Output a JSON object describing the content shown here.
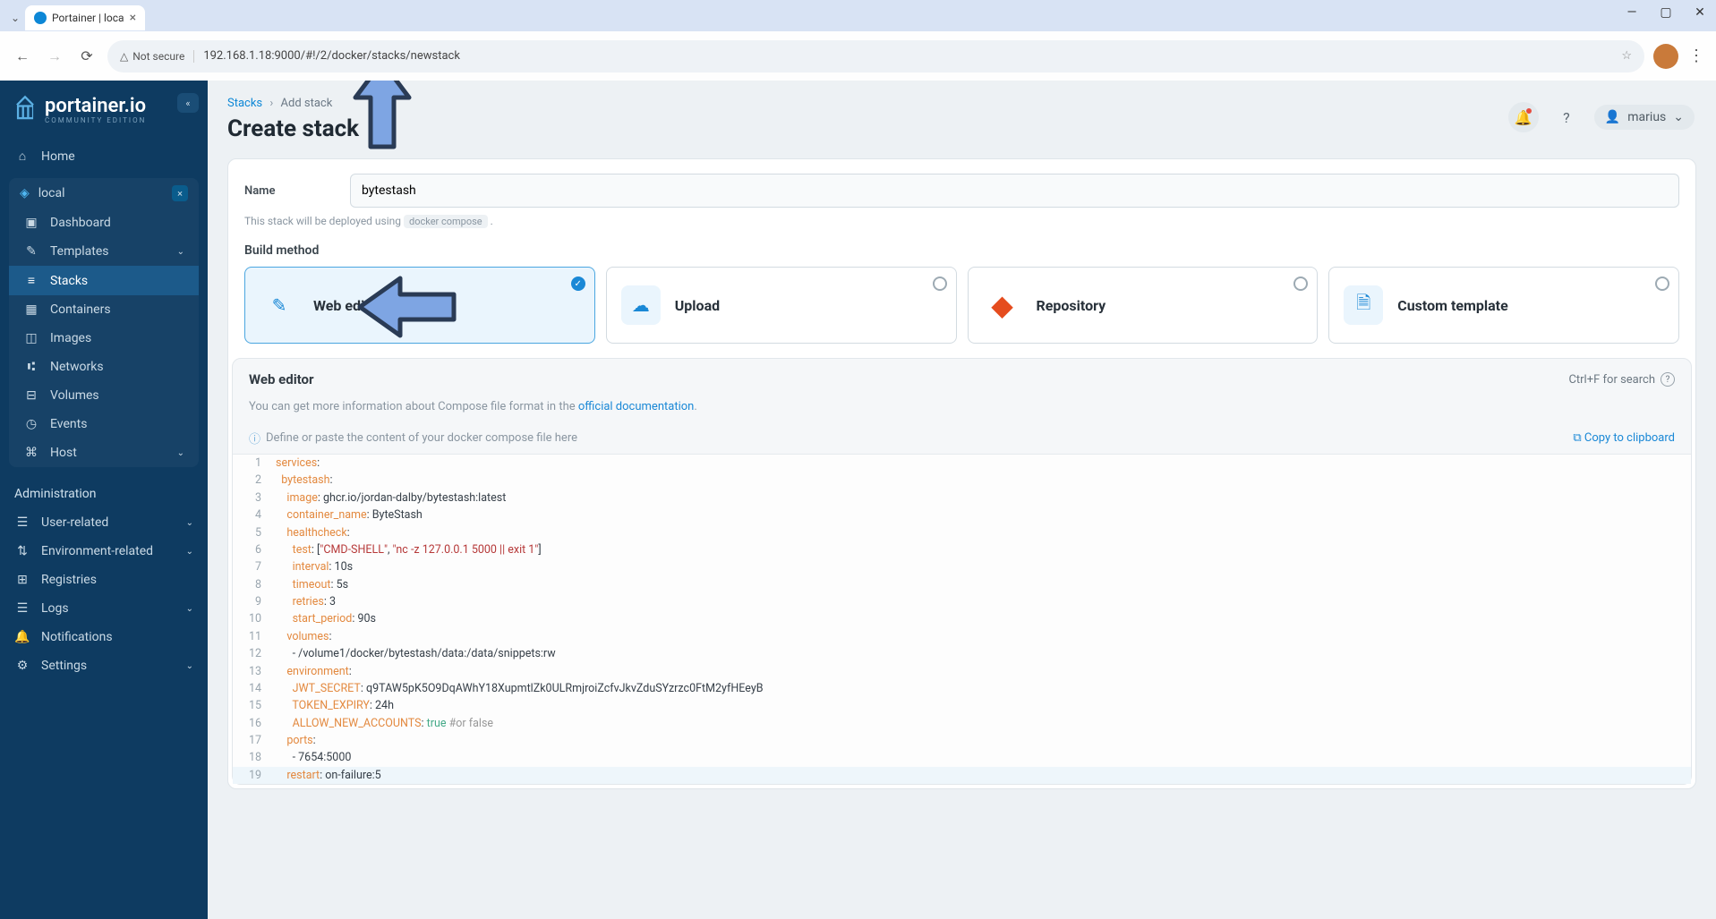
{
  "browser": {
    "tab_title": "Portainer | loca",
    "not_secure": "Not secure",
    "url": "192.168.1.18:9000/#!/2/docker/stacks/newstack"
  },
  "brand": {
    "name": "portainer.io",
    "edition": "COMMUNITY EDITION"
  },
  "sidebar": {
    "home": "Home",
    "env_name": "local",
    "items": [
      "Dashboard",
      "Templates",
      "Stacks",
      "Containers",
      "Images",
      "Networks",
      "Volumes",
      "Events",
      "Host"
    ],
    "admin_label": "Administration",
    "admin": [
      "User-related",
      "Environment-related",
      "Registries",
      "Logs",
      "Notifications",
      "Settings"
    ]
  },
  "breadcrumb": {
    "root": "Stacks",
    "current": "Add stack"
  },
  "page_title": "Create stack",
  "user_name": "marius",
  "form": {
    "name_label": "Name",
    "name_value": "bytestash",
    "deploy_hint_pre": "This stack will be deployed using",
    "deploy_hint_code": "docker compose",
    "deploy_hint_post": "."
  },
  "build": {
    "heading": "Build method",
    "methods": [
      "Web editor",
      "Upload",
      "Repository",
      "Custom template"
    ]
  },
  "editor": {
    "title": "Web editor",
    "search_hint": "Ctrl+F for search",
    "info_pre": "You can get more information about Compose file format in the ",
    "info_link": "official documentation",
    "info_post": ".",
    "placeholder_hint": "Define or paste the content of your docker compose file here",
    "copy": "Copy to clipboard"
  },
  "code": [
    {
      "n": 1,
      "html": "<span class='tok-key'>services</span>:"
    },
    {
      "n": 2,
      "html": "  <span class='tok-key'>bytestash</span>:"
    },
    {
      "n": 3,
      "html": "    <span class='tok-key'>image</span>: ghcr.io/jordan-dalby/bytestash:latest"
    },
    {
      "n": 4,
      "html": "    <span class='tok-key'>container_name</span>: ByteStash"
    },
    {
      "n": 5,
      "html": "    <span class='tok-key'>healthcheck</span>:"
    },
    {
      "n": 6,
      "html": "      <span class='tok-key'>test</span>: [<span class='tok-str'>\"CMD-SHELL\"</span>, <span class='tok-str'>\"nc -z 127.0.0.1 5000 || exit 1\"</span>]"
    },
    {
      "n": 7,
      "html": "      <span class='tok-key'>interval</span>: 10s"
    },
    {
      "n": 8,
      "html": "      <span class='tok-key'>timeout</span>: 5s"
    },
    {
      "n": 9,
      "html": "      <span class='tok-key'>retries</span>: 3"
    },
    {
      "n": 10,
      "html": "      <span class='tok-key'>start_period</span>: 90s"
    },
    {
      "n": 11,
      "html": "    <span class='tok-key'>volumes</span>:"
    },
    {
      "n": 12,
      "html": "      - /volume1/docker/bytestash/data:/data/snippets:rw"
    },
    {
      "n": 13,
      "html": "    <span class='tok-key'>environment</span>:"
    },
    {
      "n": 14,
      "html": "      <span class='tok-key'>JWT_SECRET</span>: q9TAW5pK5O9DqAWhY18XupmtlZk0ULRmjroiZcfvJkvZduSYzrzc0FtM2yfHEeyB"
    },
    {
      "n": 15,
      "html": "      <span class='tok-key'>TOKEN_EXPIRY</span>: 24h"
    },
    {
      "n": 16,
      "html": "      <span class='tok-key'>ALLOW_NEW_ACCOUNTS</span>: <span class='tok-bool'>true</span> <span class='tok-comment'>#or false</span>"
    },
    {
      "n": 17,
      "html": "    <span class='tok-key'>ports</span>:"
    },
    {
      "n": 18,
      "html": "      - 7654:5000"
    },
    {
      "n": 19,
      "html": "    <span class='tok-key'>restart</span>: on-failure:5",
      "hl": true
    }
  ]
}
